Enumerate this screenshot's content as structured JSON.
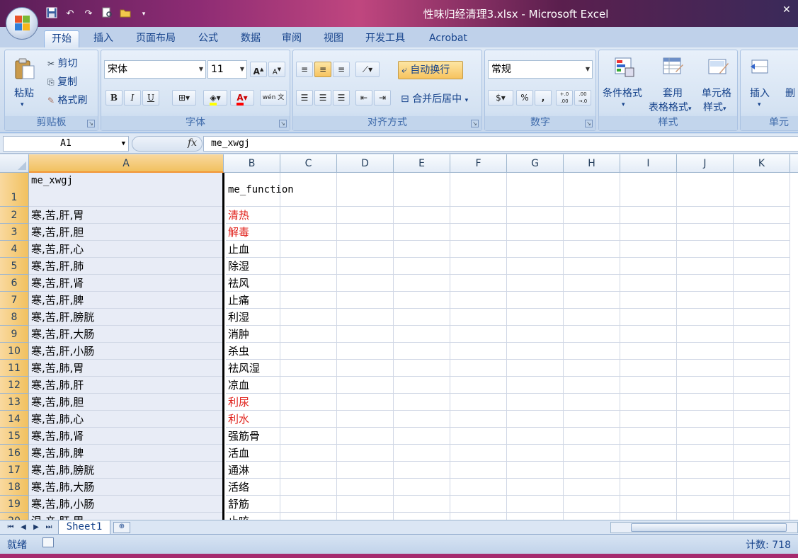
{
  "window": {
    "title": "性味归经清理3.xlsx - Microsoft Excel",
    "close_glyph": "✕"
  },
  "qat": [
    "save-icon",
    "undo-icon",
    "redo-icon",
    "print-preview-icon",
    "open-icon",
    "customize-icon"
  ],
  "tabs": [
    {
      "label": "开始",
      "active": true
    },
    {
      "label": "插入"
    },
    {
      "label": "页面布局"
    },
    {
      "label": "公式"
    },
    {
      "label": "数据"
    },
    {
      "label": "审阅"
    },
    {
      "label": "视图"
    },
    {
      "label": "开发工具"
    },
    {
      "label": "Acrobat"
    }
  ],
  "ribbon": {
    "clipboard": {
      "label": "剪贴板",
      "paste": "粘贴",
      "cut": "剪切",
      "copy": "复制",
      "format_painter": "格式刷"
    },
    "font": {
      "label": "字体",
      "font_name": "宋体",
      "font_size": "11",
      "grow": "A",
      "shrink": "A",
      "bold": "B",
      "italic": "I",
      "underline": "U",
      "phonetic": "wén 文"
    },
    "alignment": {
      "label": "对齐方式",
      "wrap_text": "自动换行",
      "merge_center": "合并后居中"
    },
    "number": {
      "label": "数字",
      "format": "常规",
      "percent": "%",
      "comma": ",",
      "inc_decimal": "+.0 .00",
      "dec_decimal": ".00 →.0"
    },
    "styles": {
      "label": "样式",
      "conditional": "条件格式",
      "table_format_1": "套用",
      "table_format_2": "表格格式",
      "cell_style_1": "单元格",
      "cell_style_2": "样式"
    },
    "cells": {
      "label": "单元",
      "insert": "插入",
      "delete": "删"
    }
  },
  "formula_bar": {
    "name_box": "A1",
    "fx": "fx",
    "content": "me_xwgj"
  },
  "columns": [
    "A",
    "B",
    "C",
    "D",
    "E",
    "F",
    "G",
    "H",
    "I",
    "J",
    "K"
  ],
  "rows": [
    {
      "num": "1",
      "a": "me_xwgj",
      "b": "me_function",
      "red": false
    },
    {
      "num": "2",
      "a": "寒,苦,肝,胃",
      "b": "清热",
      "red": true
    },
    {
      "num": "3",
      "a": "寒,苦,肝,胆",
      "b": "解毒",
      "red": true
    },
    {
      "num": "4",
      "a": "寒,苦,肝,心",
      "b": "止血",
      "red": false
    },
    {
      "num": "5",
      "a": "寒,苦,肝,肺",
      "b": "除湿",
      "red": false
    },
    {
      "num": "6",
      "a": "寒,苦,肝,肾",
      "b": "祛风",
      "red": false
    },
    {
      "num": "7",
      "a": "寒,苦,肝,脾",
      "b": "止痛",
      "red": false
    },
    {
      "num": "8",
      "a": "寒,苦,肝,膀胱",
      "b": "利湿",
      "red": false
    },
    {
      "num": "9",
      "a": "寒,苦,肝,大肠",
      "b": "消肿",
      "red": false
    },
    {
      "num": "10",
      "a": "寒,苦,肝,小肠",
      "b": "杀虫",
      "red": false
    },
    {
      "num": "11",
      "a": "寒,苦,肺,胃",
      "b": "祛风湿",
      "red": false
    },
    {
      "num": "12",
      "a": "寒,苦,肺,肝",
      "b": "凉血",
      "red": false
    },
    {
      "num": "13",
      "a": "寒,苦,肺,胆",
      "b": "利尿",
      "red": true
    },
    {
      "num": "14",
      "a": "寒,苦,肺,心",
      "b": "利水",
      "red": true
    },
    {
      "num": "15",
      "a": "寒,苦,肺,肾",
      "b": "强筋骨",
      "red": false
    },
    {
      "num": "16",
      "a": "寒,苦,肺,脾",
      "b": "活血",
      "red": false
    },
    {
      "num": "17",
      "a": "寒,苦,肺,膀胱",
      "b": "通淋",
      "red": false
    },
    {
      "num": "18",
      "a": "寒,苦,肺,大肠",
      "b": "活络",
      "red": false
    },
    {
      "num": "19",
      "a": "寒,苦,肺,小肠",
      "b": "舒筋",
      "red": false
    },
    {
      "num": "20",
      "a": "温,辛,肝,胃",
      "b": "止咳",
      "red": false
    }
  ],
  "sheet_tabs": [
    "Sheet1"
  ],
  "status": {
    "ready": "就绪",
    "count": "计数: 718"
  },
  "colors": {
    "red_text": "#e0201a",
    "selected_header": "#f1c15f"
  }
}
